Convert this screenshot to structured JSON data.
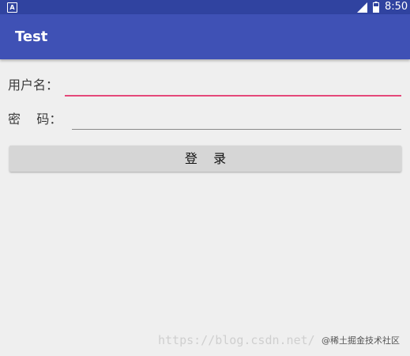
{
  "status_bar": {
    "app_badge": "A",
    "signal_icon": "signal-icon",
    "battery_icon": "battery-icon",
    "time": "8:50",
    "background": "#3043a0"
  },
  "toolbar": {
    "title": "Test",
    "background": "#3f51b5"
  },
  "form": {
    "username_label": "用户名：",
    "username_value": "",
    "password_label": "密    码：",
    "password_value": "",
    "accent_color": "#e5487a"
  },
  "login_button": {
    "label": "登    录"
  },
  "watermark": {
    "url": "https://blog.csdn.net/",
    "brand": "@稀土掘金技术社区"
  }
}
